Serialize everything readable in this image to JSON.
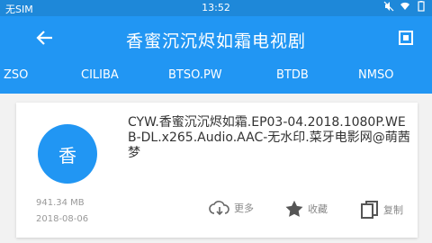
{
  "status_bar": {
    "carrier": "无SIM",
    "time": "13:52"
  },
  "app_bar": {
    "title": "香蜜沉沉烬如霜电视剧"
  },
  "tabs": [
    {
      "label": "ZSO"
    },
    {
      "label": "CILIBA"
    },
    {
      "label": "BTSO.PW"
    },
    {
      "label": "BTDB"
    },
    {
      "label": "NMSO"
    }
  ],
  "result": {
    "avatar_text": "香",
    "name": "CYW.香蜜沉沉烬如霜.EP03-04.2018.1080P.WEB-DL.x265.Audio.AAC-无水印.菜牙电影网@萌茜梦",
    "size": "941.34 MB",
    "date": "2018-08-06",
    "actions": {
      "more": "更多",
      "favorite": "收藏",
      "copy": "复制"
    }
  },
  "colors": {
    "primary": "#2196f3",
    "status_bar": "#1e88d9"
  }
}
